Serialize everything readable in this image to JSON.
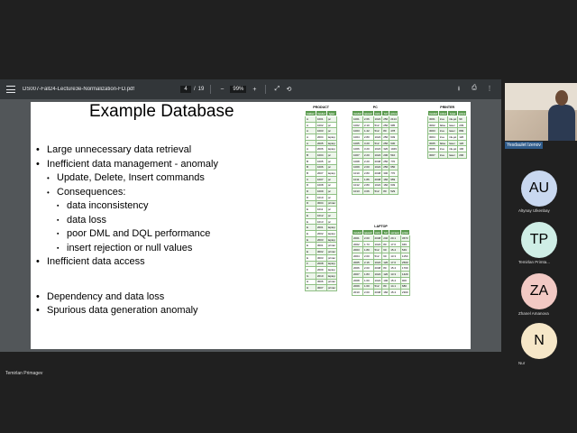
{
  "viewer": {
    "filename": "DS007-Fall24-Lecture3e-Normalization-FD.pdf",
    "page_current": "4",
    "page_total": "19",
    "zoom": "99%"
  },
  "slide": {
    "title": "Example Database",
    "bullets": [
      {
        "level": 1,
        "text": "Large unnecessary data retrieval"
      },
      {
        "level": 1,
        "text": "Inefficient data management - anomaly"
      },
      {
        "level": 2,
        "text": "Update, Delete, Insert commands"
      },
      {
        "level": 2,
        "text": "Consequences:"
      },
      {
        "level": 3,
        "text": "data inconsistency"
      },
      {
        "level": 3,
        "text": "data loss"
      },
      {
        "level": 3,
        "text": "poor DML and DQL performance"
      },
      {
        "level": 3,
        "text": "insert rejection or null values"
      },
      {
        "level": 1,
        "text": "Inefficient data access"
      },
      {
        "level": 0,
        "text": ""
      },
      {
        "level": 1,
        "text": "Dependency and data loss"
      },
      {
        "level": 1,
        "text": "Spurious data generation anomaly"
      }
    ]
  },
  "tables": {
    "product": {
      "title": "PRODUCT",
      "headers": [
        "maker",
        "model",
        "type"
      ],
      "rows": [
        [
          "A",
          "1001",
          "pc"
        ],
        [
          "A",
          "1002",
          "pc"
        ],
        [
          "A",
          "1003",
          "pc"
        ],
        [
          "A",
          "2004",
          "laptop"
        ],
        [
          "A",
          "2005",
          "laptop"
        ],
        [
          "A",
          "2006",
          "laptop"
        ],
        [
          "B",
          "1004",
          "pc"
        ],
        [
          "B",
          "1005",
          "pc"
        ],
        [
          "B",
          "1006",
          "pc"
        ],
        [
          "B",
          "2007",
          "laptop"
        ],
        [
          "C",
          "1007",
          "pc"
        ],
        [
          "D",
          "1008",
          "pc"
        ],
        [
          "D",
          "1009",
          "pc"
        ],
        [
          "D",
          "1010",
          "pc"
        ],
        [
          "D",
          "3004",
          "printer"
        ],
        [
          "E",
          "1011",
          "pc"
        ],
        [
          "E",
          "1012",
          "pc"
        ],
        [
          "E",
          "1013",
          "pc"
        ],
        [
          "E",
          "2001",
          "laptop"
        ],
        [
          "E",
          "2002",
          "laptop"
        ],
        [
          "E",
          "2003",
          "laptop"
        ],
        [
          "E",
          "3001",
          "printer"
        ],
        [
          "E",
          "3002",
          "printer"
        ],
        [
          "E",
          "3003",
          "printer"
        ],
        [
          "F",
          "2008",
          "laptop"
        ],
        [
          "F",
          "2009",
          "laptop"
        ],
        [
          "G",
          "2010",
          "laptop"
        ],
        [
          "H",
          "3006",
          "printer"
        ],
        [
          "H",
          "3007",
          "printer"
        ]
      ]
    },
    "pc": {
      "title": "PC",
      "headers": [
        "model",
        "speed",
        "ram",
        "hd",
        "price"
      ],
      "rows": [
        [
          "1001",
          "2.66",
          "1024",
          "250",
          "2114"
        ],
        [
          "1002",
          "2.10",
          "512",
          "250",
          "995"
        ],
        [
          "1003",
          "1.42",
          "512",
          "80",
          "478"
        ],
        [
          "1004",
          "2.80",
          "1024",
          "250",
          "649"
        ],
        [
          "1005",
          "3.20",
          "512",
          "250",
          "630"
        ],
        [
          "1006",
          "3.20",
          "1024",
          "320",
          "1049"
        ],
        [
          "1007",
          "2.20",
          "1024",
          "200",
          "510"
        ],
        [
          "1008",
          "2.20",
          "2048",
          "250",
          "770"
        ],
        [
          "1009",
          "2.00",
          "1024",
          "250",
          "650"
        ],
        [
          "1010",
          "2.80",
          "2048",
          "300",
          "770"
        ],
        [
          "1011",
          "1.86",
          "2048",
          "160",
          "959"
        ],
        [
          "1012",
          "2.80",
          "1024",
          "160",
          "649"
        ],
        [
          "1013",
          "3.06",
          "512",
          "80",
          "529"
        ]
      ]
    },
    "printer": {
      "title": "PRINTER",
      "headers": [
        "model",
        "color",
        "type",
        "price"
      ],
      "rows": [
        [
          "3001",
          "true",
          "ink-jet",
          "99"
        ],
        [
          "3002",
          "false",
          "laser",
          "239"
        ],
        [
          "3003",
          "true",
          "laser",
          "899"
        ],
        [
          "3004",
          "true",
          "ink-jet",
          "120"
        ],
        [
          "3005",
          "false",
          "laser",
          "120"
        ],
        [
          "3006",
          "true",
          "ink-jet",
          "100"
        ],
        [
          "3007",
          "true",
          "laser",
          "200"
        ]
      ]
    },
    "laptop": {
      "title": "LAPTOP",
      "headers": [
        "model",
        "speed",
        "ram",
        "hd",
        "screen",
        "price"
      ],
      "rows": [
        [
          "2001",
          "2.00",
          "2048",
          "240",
          "20.1",
          "3673"
        ],
        [
          "2002",
          "1.73",
          "1024",
          "80",
          "17.0",
          "949"
        ],
        [
          "2003",
          "1.80",
          "512",
          "60",
          "15.4",
          "549"
        ],
        [
          "2004",
          "2.00",
          "512",
          "60",
          "13.3",
          "1150"
        ],
        [
          "2005",
          "2.16",
          "1024",
          "120",
          "17.0",
          "2500"
        ],
        [
          "2006",
          "2.00",
          "2048",
          "80",
          "15.4",
          "1700"
        ],
        [
          "2007",
          "1.83",
          "1024",
          "120",
          "13.3",
          "1429"
        ],
        [
          "2008",
          "1.60",
          "1024",
          "100",
          "15.4",
          "900"
        ],
        [
          "2009",
          "1.60",
          "512",
          "80",
          "14.1",
          "680"
        ],
        [
          "2010",
          "2.00",
          "2048",
          "160",
          "15.4",
          "2300"
        ]
      ]
    }
  },
  "participants": {
    "presenter_tag": "Yesdaulet Izenov",
    "list": [
      {
        "initials": "AU",
        "name": "Altynay Ulkenbay",
        "color": "#c9d8f0"
      },
      {
        "initials": "TP",
        "name": "Temirlan Primta...",
        "color": "#cfeee6"
      },
      {
        "initials": "ZA",
        "name": "Zhanel Amanova",
        "color": "#f2c9c4"
      },
      {
        "initials": "N",
        "name": "Nur",
        "color": "#f6e7c8"
      }
    ]
  },
  "active_speaker": "Temirlan Primagev"
}
